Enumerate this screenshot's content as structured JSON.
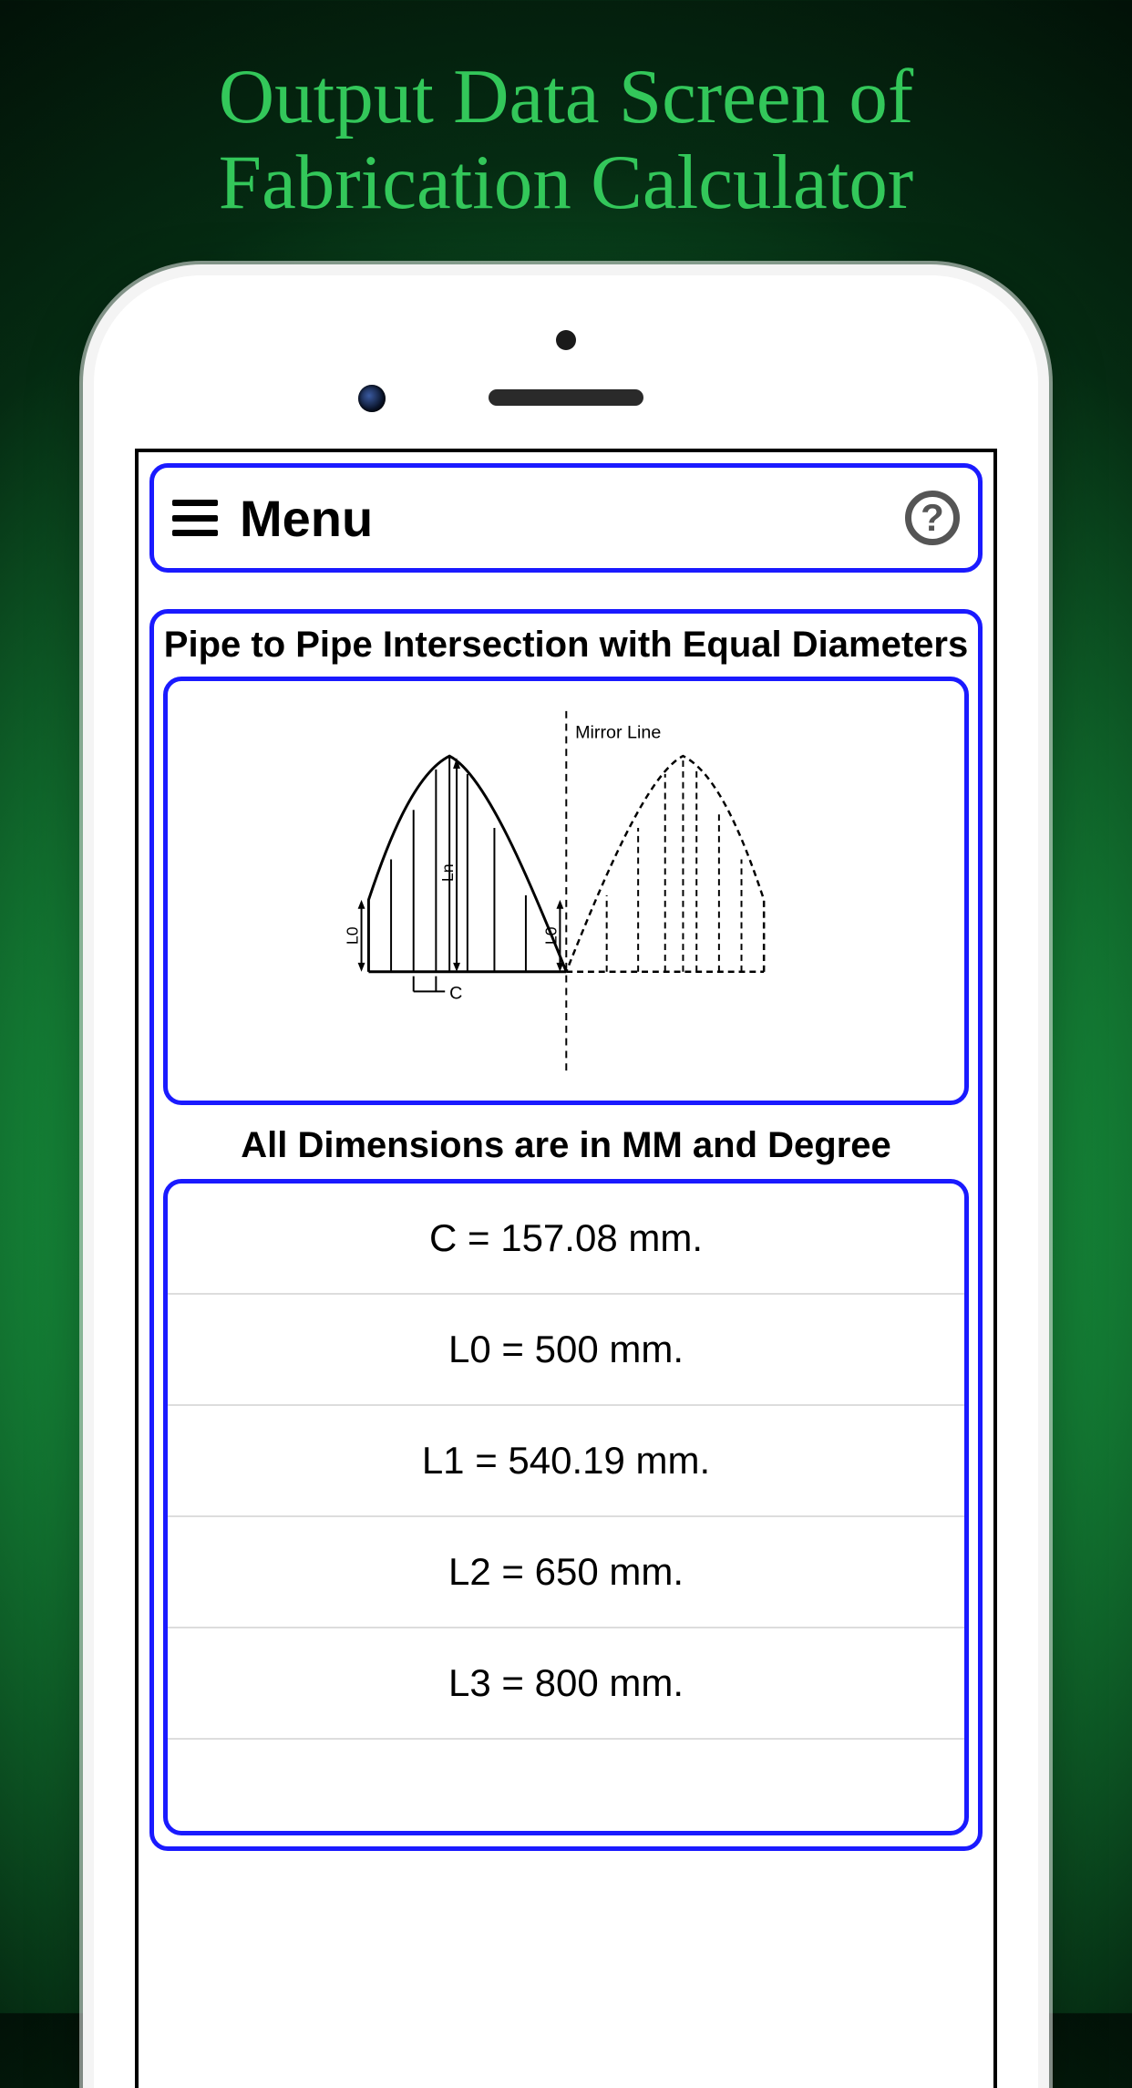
{
  "promo": {
    "line1": "Output Data Screen of",
    "line2": "Fabrication Calculator"
  },
  "header": {
    "menu_label": "Menu"
  },
  "card": {
    "title": "Pipe to Pipe Intersection with Equal Diameters",
    "diagram": {
      "mirror_label": "Mirror Line",
      "L0_label": "L0",
      "Ln_label": "Ln",
      "C_label": "C"
    },
    "dimensions_note": "All Dimensions are in MM and Degree",
    "results": [
      "C = 157.08 mm.",
      "L0 = 500 mm.",
      "L1 = 540.19 mm.",
      "L2 = 650 mm.",
      "L3 = 800 mm."
    ]
  }
}
